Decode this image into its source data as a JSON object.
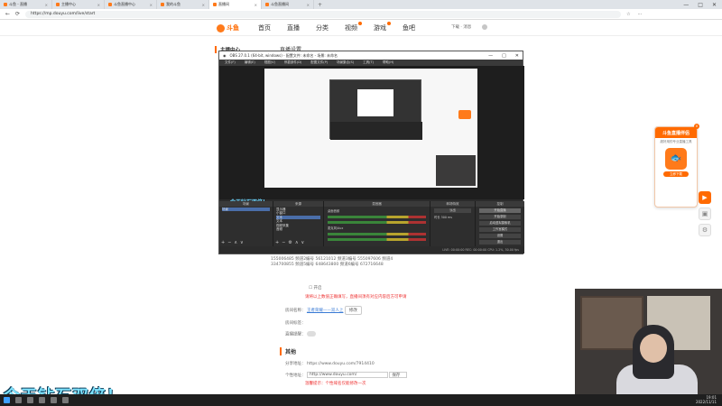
{
  "browser": {
    "tabs": [
      {
        "label": "斗鱼 - 直播"
      },
      {
        "label": "主播中心"
      },
      {
        "label": "斗鱼直播中心"
      },
      {
        "label": "我的斗鱼"
      },
      {
        "label": "直播间"
      },
      {
        "label": "斗鱼直播间"
      }
    ],
    "url": "https://mp.douyu.com/live/start"
  },
  "header": {
    "logo_text": "斗鱼",
    "nav": [
      "首页",
      "直播",
      "分类",
      "视频",
      "游戏",
      "鱼吧"
    ],
    "user_text": "下载 · 消息"
  },
  "sidebar": {
    "title": "主播中心"
  },
  "main": {
    "section_title": "直播设置",
    "ids_line1": "155006485 频道2编号   56121012 频道3编号   555097606 频道4",
    "ids_line2": "334700855 频道5编号   648643800 频道6编号   672716648",
    "open_label": "开启",
    "red_note": "请将以上数值正确填写，直播间须有对应内容后方可申请",
    "room_label": "房间名称：",
    "room_link": "王者荣耀——双人上",
    "modify_btn": "修改",
    "room_tag_label": "房间标签：",
    "live_reminder_label": "直播提醒：",
    "other_title": "其他",
    "share_label": "分享地址：",
    "share_url": "https://www.douyu.com/7914410",
    "custom_label": "个性地址：",
    "custom_url": "http://www.douyu.com/",
    "custom_select": "保存",
    "custom_note": "温馨提示：个性域名仅能修改一次"
  },
  "obs": {
    "title": "OBS 27.0.1 (64-bit, windows) - 配置文件: 未命名 - 场景: 未命名",
    "menu": [
      "文件(F)",
      "编辑(E)",
      "视图(V)",
      "停靠部件(D)",
      "配置文件(P)",
      "场景集合(S)",
      "工具(T)",
      "帮助(H)"
    ],
    "stream_overlay": "今天钻石双倍！",
    "docks": {
      "scenes_title": "场景",
      "scenes": [
        "场景"
      ],
      "sources_title": "来源",
      "sources": [
        "显示器",
        "小窗口",
        "文本",
        "文本",
        "视频采集",
        "音频"
      ],
      "mixer_title": "混音器",
      "mixer_items": [
        "桌面音频",
        "麦克风/Aux"
      ],
      "transitions_title": "转场特效",
      "transition_value": "淡出",
      "duration_label": "时长",
      "duration_value": "300 ms",
      "controls_title": "控制",
      "controls": [
        "开始直播",
        "开始录制",
        "启动虚拟摄像机",
        "工作室模式",
        "设置",
        "退出"
      ]
    },
    "status": "LIVE: 00:00:00   REC: 00:00:00   CPU: 1.2%, 30.00 fps"
  },
  "promo": {
    "title": "斗鱼直播伴侣",
    "text": "超好用的专业直播工具",
    "button": "立即下载"
  },
  "taskbar": {
    "time": "19:01",
    "date": "2022/11/11"
  },
  "colors": {
    "brand": "#ff6a00",
    "obs_bg": "#2b2b2b",
    "overlay_text": "#7fe3ff"
  }
}
